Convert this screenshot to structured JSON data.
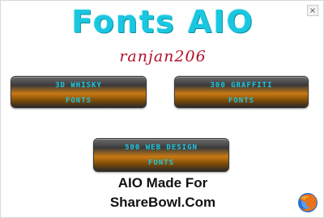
{
  "window": {
    "title": "Fonts AIO",
    "author": "ranjan206",
    "close_label": "×"
  },
  "buttons": [
    {
      "line1": "3D WHISKY",
      "line2": "FONTS"
    },
    {
      "line1": "300 GRAFFITI",
      "line2": "FONTS"
    },
    {
      "line1": "500 WEB DESIGN",
      "line2": "FONTS"
    }
  ],
  "footer": {
    "line1": "AIO Made For",
    "line2": "ShareBowl.Com"
  },
  "icons": {
    "close": "close-icon",
    "browser": "firefox-icon"
  },
  "colors": {
    "title": "#19c7e0",
    "author": "#b2102a",
    "button_orange": "#c97a12"
  }
}
